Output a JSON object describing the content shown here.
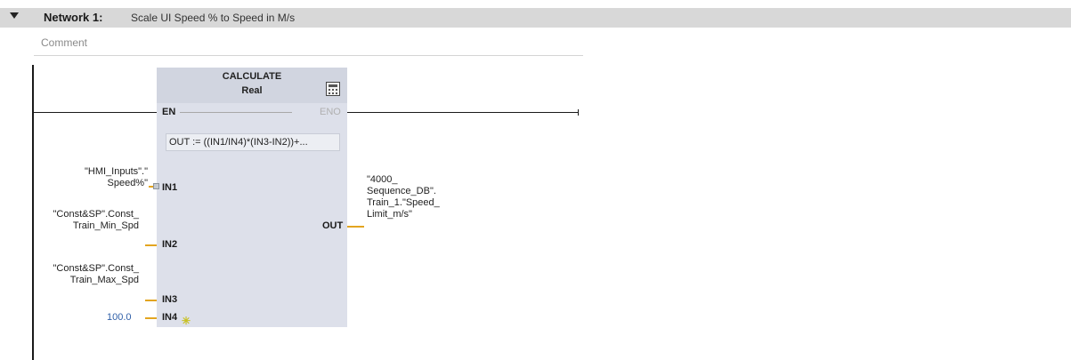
{
  "network": {
    "title": "Network 1:",
    "description": "Scale UI Speed % to Speed in M/s",
    "comment_placeholder": "Comment"
  },
  "block": {
    "name": "CALCULATE",
    "type": "Real",
    "en": "EN",
    "eno": "ENO",
    "formula": "OUT :=   ((IN1/IN4)*(IN3-IN2))+...",
    "pins": {
      "in1": "IN1",
      "in2": "IN2",
      "in3": "IN3",
      "in4": "IN4",
      "out": "OUT"
    }
  },
  "operands": {
    "in1": [
      "\"HMI_Inputs\".\"",
      "Speed%\""
    ],
    "in2": [
      "\"Const&SP\".Const_",
      "Train_Min_Spd"
    ],
    "in3": [
      "\"Const&SP\".Const_",
      "Train_Max_Spd"
    ],
    "in4": "100.0",
    "out": [
      "\"4000_",
      "Sequence_DB\".",
      "Train_1.\"Speed_",
      "Limit_m/s\""
    ]
  },
  "colors": {
    "header_bg": "#d8d8d8",
    "block_bg": "#dde0ea",
    "wire_orange": "#e3a520",
    "constant_blue": "#2f5fa8"
  },
  "icons": [
    "collapse-triangle-icon",
    "calculator-icon",
    "add-input-icon"
  ]
}
